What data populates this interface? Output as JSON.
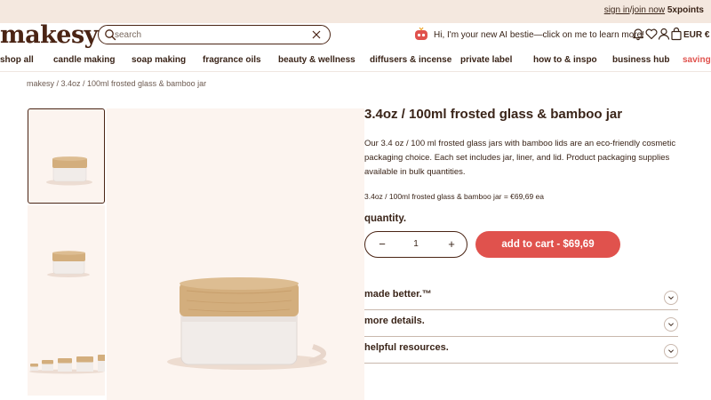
{
  "topbar": {
    "sign_in": "sign in",
    "separator": "/",
    "join_now": "join now",
    "points": "5xpoints"
  },
  "header": {
    "logo": "makesy",
    "search_placeholder": "search",
    "ai_text": "Hi, I'm your new AI bestie—click on me to learn more!",
    "currency": "EUR €"
  },
  "nav": {
    "items": [
      "shop all",
      "candle making",
      "soap making",
      "fragrance oils",
      "beauty & wellness",
      "diffusers & incense",
      "private label",
      "how to & inspo",
      "business hub",
      "savings"
    ]
  },
  "breadcrumb": "makesy / 3.4oz / 100ml frosted glass & bamboo jar",
  "product": {
    "title": "3.4oz / 100ml frosted glass & bamboo jar",
    "description": "Our 3.4 oz / 100 ml frosted glass jars with bamboo lids are an eco-friendly cosmetic packaging choice. Each set includes jar, liner, and lid. Product packaging supplies available in bulk quantities.",
    "price_line": "3.4oz / 100ml frosted glass & bamboo jar = €69,69 ea",
    "quantity_label": "quantity.",
    "quantity_minus": "−",
    "quantity_value": "1",
    "quantity_plus": "+",
    "add_to_cart": "add to cart - $69,69"
  },
  "accordions": [
    "made better.™",
    "more details.",
    "helpful resources."
  ],
  "colors": {
    "brand_brown": "#4a2414",
    "accent_red": "#e0524d",
    "topbar_bg": "#f4e8df",
    "image_bg": "#fcf4ef",
    "bamboo": "#d3ae7d",
    "frosted_glass": "#f1ece9"
  },
  "icons": [
    "search-icon",
    "close-icon",
    "ai-bestie-icon",
    "bell-icon",
    "heart-icon",
    "user-icon",
    "bag-icon",
    "chevron-down-icon"
  ]
}
